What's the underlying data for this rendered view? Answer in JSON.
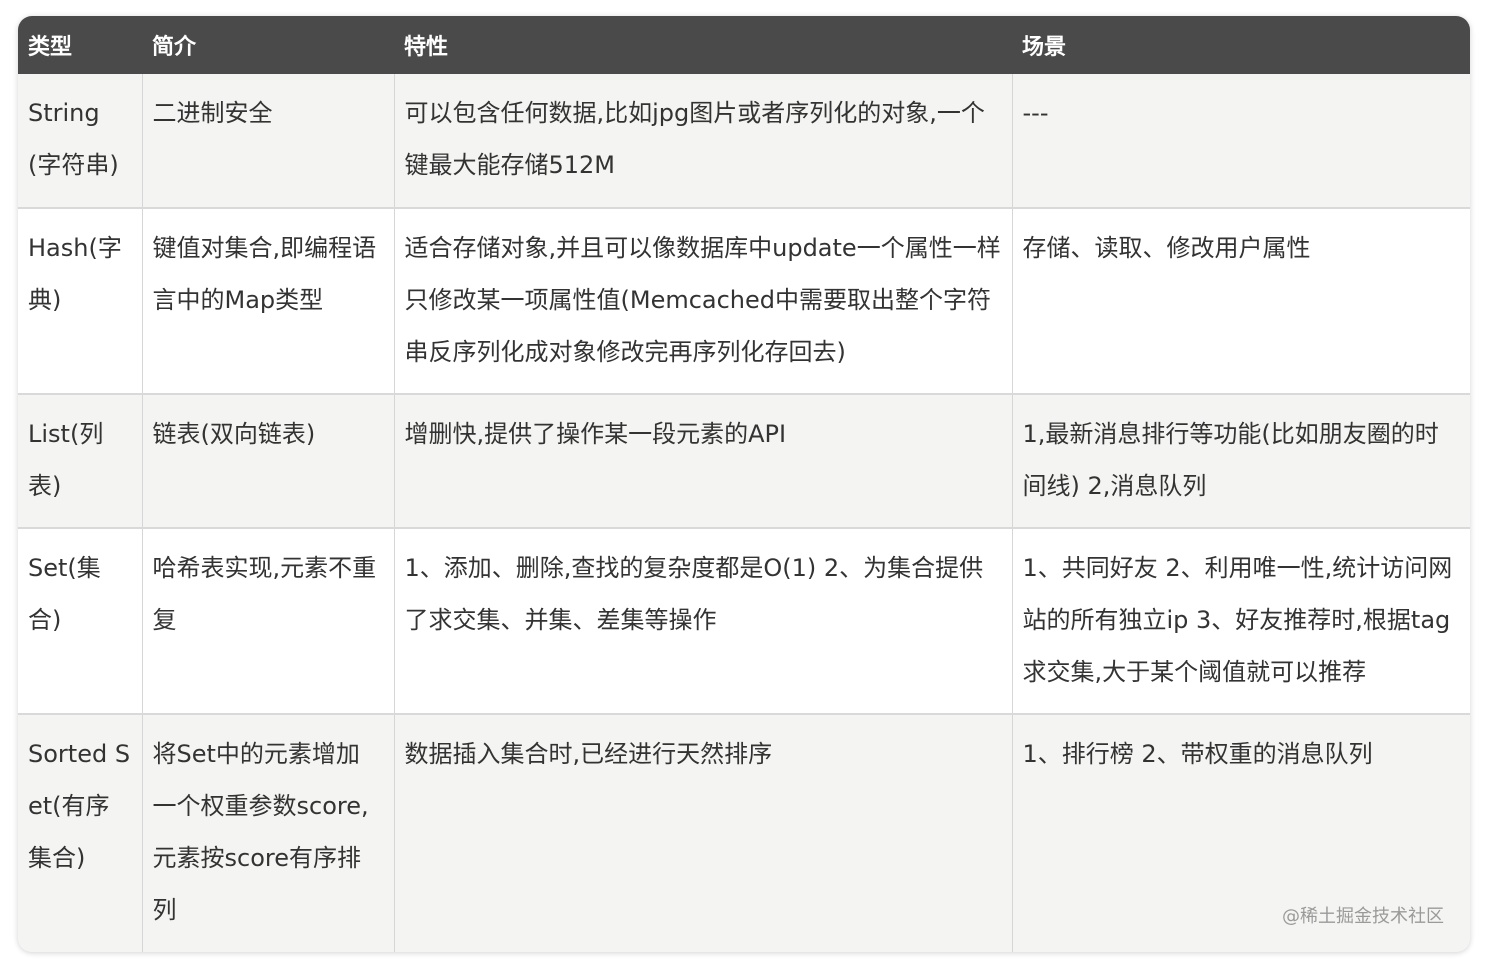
{
  "table": {
    "headers": [
      "类型",
      "简介",
      "特性",
      "场景"
    ],
    "rows": [
      [
        "String(字符串)",
        "二进制安全",
        "可以包含任何数据,比如jpg图片或者序列化的对象,一个键最大能存储512M",
        "---"
      ],
      [
        "Hash(字典)",
        "键值对集合,即编程语言中的Map类型",
        "适合存储对象,并且可以像数据库中update一个属性一样只修改某一项属性值(Memcached中需要取出整个字符串反序列化成对象修改完再序列化存回去)",
        "存储、读取、修改用户属性"
      ],
      [
        "List(列表)",
        "链表(双向链表)",
        "增删快,提供了操作某一段元素的API",
        "1,最新消息排行等功能(比如朋友圈的时间线) 2,消息队列"
      ],
      [
        "Set(集合)",
        "哈希表实现,元素不重复",
        "1、添加、删除,查找的复杂度都是O(1) 2、为集合提供了求交集、并集、差集等操作",
        "1、共同好友 2、利用唯一性,统计访问网站的所有独立ip 3、好友推荐时,根据tag求交集,大于某个阈值就可以推荐"
      ],
      [
        "Sorted Set(有序集合)",
        "将Set中的元素增加一个权重参数score,元素按score有序排列",
        "数据插入集合时,已经进行天然排序",
        "1、排行榜 2、带权重的消息队列"
      ]
    ]
  },
  "watermark": "@稀土掘金技术社区",
  "colors": {
    "header_bg": "#4a4a4a",
    "header_text": "#ffffff",
    "row_odd": "#f4f4f2",
    "row_even": "#ffffff",
    "text": "#333333"
  }
}
